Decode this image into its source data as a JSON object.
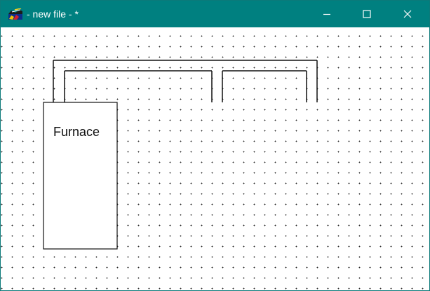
{
  "window": {
    "title": "- new file - *",
    "app_icon": "app-logo-icon",
    "controls": {
      "minimize": "minimize-icon",
      "maximize": "maximize-icon",
      "close": "close-icon"
    },
    "colors": {
      "titlebar": "#008080",
      "title_text": "#ffffff"
    }
  },
  "canvas": {
    "grid": "dotted",
    "components": [
      {
        "type": "furnace",
        "label": "Furnace"
      }
    ],
    "pipes": [
      {
        "from": "furnace",
        "to": "right-outlet"
      },
      {
        "from": "furnace",
        "to": "middle-inlet"
      },
      {
        "from": "middle-outlet",
        "to": "right-inlet"
      }
    ]
  }
}
